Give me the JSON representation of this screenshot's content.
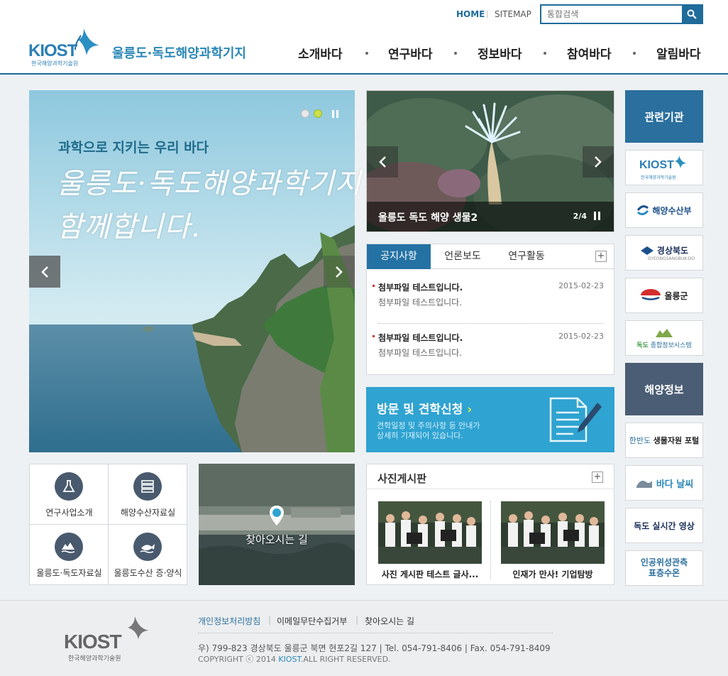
{
  "header": {
    "util_home": "HOME",
    "util_sitemap": "SITEMAP",
    "search_placeholder": "통합검색",
    "logo_text": "KIOST",
    "logo_sub": "한국해양과학기술원",
    "site_title": "울릉도·독도해양과학기지",
    "nav": [
      "소개바다",
      "연구바다",
      "정보바다",
      "참여바다",
      "알림바다"
    ]
  },
  "main_visual": {
    "tagline": "과학으로 지키는 우리 바다",
    "headline_line1": "울릉도·독도해양과학기지가",
    "headline_line2": "함께합니다."
  },
  "marine_slide": {
    "title": "울릉도 독도 해양 생물2",
    "counter": "2/4"
  },
  "notice": {
    "tabs": [
      "공지사항",
      "언론보도",
      "연구활동"
    ],
    "plus": "+",
    "items": [
      {
        "title": "첨부파일 테스트입니다.",
        "date": "2015-02-23",
        "desc": "첨부파일 테스트입니다."
      },
      {
        "title": "첨부파일 테스트입니다.",
        "date": "2015-02-23",
        "desc": "첨부파일 테스트입니다."
      }
    ]
  },
  "visit": {
    "title": "방문 및 견학신청",
    "desc_line1": "견학일정 및 주의사항 등 안내가",
    "desc_line2": "상세히 기재되어 있습니다."
  },
  "quick_menu": [
    {
      "label": "연구사업소개",
      "icon": "flask-icon"
    },
    {
      "label": "해양수산자료실",
      "icon": "server-icon"
    },
    {
      "label": "울릉도·독도자료실",
      "icon": "island-icon"
    },
    {
      "label": "울릉도수산 증·양식",
      "icon": "fish-icon"
    }
  ],
  "directions": {
    "label": "찾아오시는 길"
  },
  "photo_board": {
    "title": "사진게시판",
    "plus": "+",
    "items": [
      {
        "caption": "사진 게시판 테스트 글사..."
      },
      {
        "caption": "인재가 만사! 기업탐방"
      }
    ]
  },
  "sidebar": {
    "related_title": "관련기관",
    "related": [
      {
        "label": "KIOST",
        "sub": "한국해양과학기술원"
      },
      {
        "label": "해양수산부"
      },
      {
        "label": "경상북도",
        "sub": "GYEONGSANGBUK-DO"
      },
      {
        "label": "울릉군"
      },
      {
        "label": "종합정보시스템",
        "prefix": "독도"
      }
    ],
    "ocean_title": "해양정보",
    "ocean": [
      {
        "prefix": "한반도",
        "label": "생물자원 포털"
      },
      {
        "label": "바다 날씨"
      },
      {
        "label": "독도 실시간 영상"
      },
      {
        "label": "인공위성관측",
        "label2": "표층수온"
      }
    ]
  },
  "footer": {
    "links": [
      "개인정보처리방침",
      "이메일무단수집거부",
      "찾아오시는 길"
    ],
    "address": "우) 799-823 경상북도 울릉군 북면 현포2길 127  |  Tel. 054-791-8406  |  Fax. 054-791-8409",
    "copyright_pre": "COPYRIGHT ⓒ 2014",
    "copyright_brand": "KIOST",
    "copyright_post": ".ALL RIGHT RESERVED.",
    "logo_text": "KIOST",
    "logo_sub": "한국해양과학기술원"
  },
  "colors": {
    "brand": "#1f6b9a",
    "accent": "#2fa3d1",
    "tab_active": "#2472a4",
    "sidebar_head": "#2a6f9e",
    "sidebar_head_dark": "#4a5d74"
  }
}
